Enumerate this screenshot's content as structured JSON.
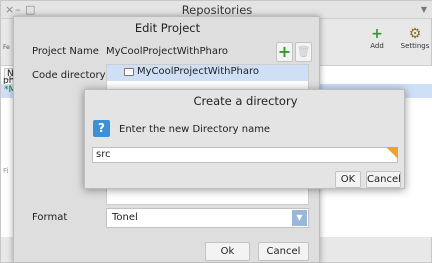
{
  "repositories": {
    "title": "Repositories",
    "controls": {
      "close": "×",
      "minimize": "–",
      "maximize": "□",
      "menu": "▼"
    },
    "toolbar": [
      {
        "label": "Add",
        "icon": "plus-icon",
        "glyph": "+",
        "color": "#2e9a2e"
      },
      {
        "label": "Settings",
        "icon": "settings-icon",
        "glyph": "⚙",
        "color": "#8a6d2e"
      }
    ],
    "peek_texts": {
      "filter_header": "Fe",
      "column_n": "N",
      "row_1": "ph",
      "row_2": "*M",
      "filter_footer": "Fi"
    }
  },
  "edit_project": {
    "title": "Edit Project",
    "name_label": "Project Name",
    "name_value": "MyCoolProjectWithPharo",
    "add_icon": "+",
    "delete_icon": "🗑",
    "code_dir_label": "Code directory",
    "tree_items": [
      {
        "label": "MyCoolProjectWithPharo",
        "icon": "folder-icon",
        "selected": true
      }
    ],
    "format_label": "Format",
    "format_value": "Tonel",
    "ok_label": "Ok",
    "cancel_label": "Cancel"
  },
  "create_directory": {
    "title": "Create a directory",
    "prompt_icon": "?",
    "prompt": "Enter the new Directory name",
    "input_value": "src",
    "ok_label": "OK",
    "cancel_label": "Cancel"
  },
  "colors": {
    "selection": "#cfe0f6",
    "accent_add": "#2e9a2e",
    "question_icon": "#3d8fd6",
    "input_corner": "#f0a030"
  }
}
